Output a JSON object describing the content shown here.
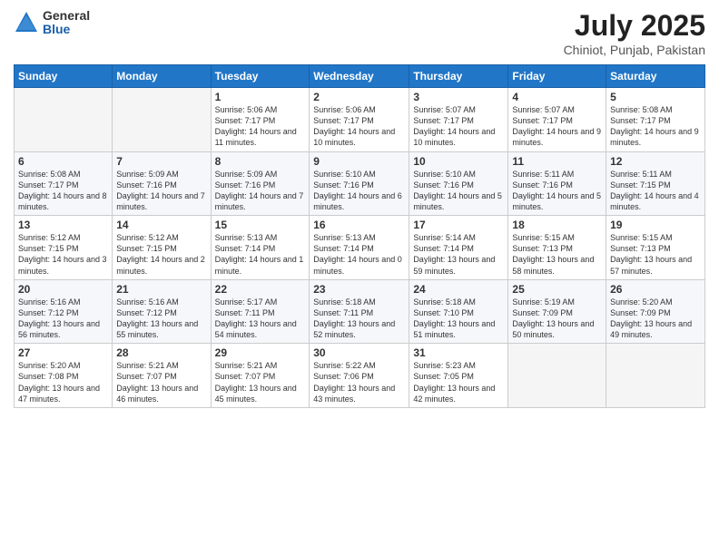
{
  "logo": {
    "general": "General",
    "blue": "Blue"
  },
  "title": "July 2025",
  "subtitle": "Chiniot, Punjab, Pakistan",
  "headers": [
    "Sunday",
    "Monday",
    "Tuesday",
    "Wednesday",
    "Thursday",
    "Friday",
    "Saturday"
  ],
  "weeks": [
    [
      {
        "day": "",
        "info": ""
      },
      {
        "day": "",
        "info": ""
      },
      {
        "day": "1",
        "info": "Sunrise: 5:06 AM\nSunset: 7:17 PM\nDaylight: 14 hours and 11 minutes."
      },
      {
        "day": "2",
        "info": "Sunrise: 5:06 AM\nSunset: 7:17 PM\nDaylight: 14 hours and 10 minutes."
      },
      {
        "day": "3",
        "info": "Sunrise: 5:07 AM\nSunset: 7:17 PM\nDaylight: 14 hours and 10 minutes."
      },
      {
        "day": "4",
        "info": "Sunrise: 5:07 AM\nSunset: 7:17 PM\nDaylight: 14 hours and 9 minutes."
      },
      {
        "day": "5",
        "info": "Sunrise: 5:08 AM\nSunset: 7:17 PM\nDaylight: 14 hours and 9 minutes."
      }
    ],
    [
      {
        "day": "6",
        "info": "Sunrise: 5:08 AM\nSunset: 7:17 PM\nDaylight: 14 hours and 8 minutes."
      },
      {
        "day": "7",
        "info": "Sunrise: 5:09 AM\nSunset: 7:16 PM\nDaylight: 14 hours and 7 minutes."
      },
      {
        "day": "8",
        "info": "Sunrise: 5:09 AM\nSunset: 7:16 PM\nDaylight: 14 hours and 7 minutes."
      },
      {
        "day": "9",
        "info": "Sunrise: 5:10 AM\nSunset: 7:16 PM\nDaylight: 14 hours and 6 minutes."
      },
      {
        "day": "10",
        "info": "Sunrise: 5:10 AM\nSunset: 7:16 PM\nDaylight: 14 hours and 5 minutes."
      },
      {
        "day": "11",
        "info": "Sunrise: 5:11 AM\nSunset: 7:16 PM\nDaylight: 14 hours and 5 minutes."
      },
      {
        "day": "12",
        "info": "Sunrise: 5:11 AM\nSunset: 7:15 PM\nDaylight: 14 hours and 4 minutes."
      }
    ],
    [
      {
        "day": "13",
        "info": "Sunrise: 5:12 AM\nSunset: 7:15 PM\nDaylight: 14 hours and 3 minutes."
      },
      {
        "day": "14",
        "info": "Sunrise: 5:12 AM\nSunset: 7:15 PM\nDaylight: 14 hours and 2 minutes."
      },
      {
        "day": "15",
        "info": "Sunrise: 5:13 AM\nSunset: 7:14 PM\nDaylight: 14 hours and 1 minute."
      },
      {
        "day": "16",
        "info": "Sunrise: 5:13 AM\nSunset: 7:14 PM\nDaylight: 14 hours and 0 minutes."
      },
      {
        "day": "17",
        "info": "Sunrise: 5:14 AM\nSunset: 7:14 PM\nDaylight: 13 hours and 59 minutes."
      },
      {
        "day": "18",
        "info": "Sunrise: 5:15 AM\nSunset: 7:13 PM\nDaylight: 13 hours and 58 minutes."
      },
      {
        "day": "19",
        "info": "Sunrise: 5:15 AM\nSunset: 7:13 PM\nDaylight: 13 hours and 57 minutes."
      }
    ],
    [
      {
        "day": "20",
        "info": "Sunrise: 5:16 AM\nSunset: 7:12 PM\nDaylight: 13 hours and 56 minutes."
      },
      {
        "day": "21",
        "info": "Sunrise: 5:16 AM\nSunset: 7:12 PM\nDaylight: 13 hours and 55 minutes."
      },
      {
        "day": "22",
        "info": "Sunrise: 5:17 AM\nSunset: 7:11 PM\nDaylight: 13 hours and 54 minutes."
      },
      {
        "day": "23",
        "info": "Sunrise: 5:18 AM\nSunset: 7:11 PM\nDaylight: 13 hours and 52 minutes."
      },
      {
        "day": "24",
        "info": "Sunrise: 5:18 AM\nSunset: 7:10 PM\nDaylight: 13 hours and 51 minutes."
      },
      {
        "day": "25",
        "info": "Sunrise: 5:19 AM\nSunset: 7:09 PM\nDaylight: 13 hours and 50 minutes."
      },
      {
        "day": "26",
        "info": "Sunrise: 5:20 AM\nSunset: 7:09 PM\nDaylight: 13 hours and 49 minutes."
      }
    ],
    [
      {
        "day": "27",
        "info": "Sunrise: 5:20 AM\nSunset: 7:08 PM\nDaylight: 13 hours and 47 minutes."
      },
      {
        "day": "28",
        "info": "Sunrise: 5:21 AM\nSunset: 7:07 PM\nDaylight: 13 hours and 46 minutes."
      },
      {
        "day": "29",
        "info": "Sunrise: 5:21 AM\nSunset: 7:07 PM\nDaylight: 13 hours and 45 minutes."
      },
      {
        "day": "30",
        "info": "Sunrise: 5:22 AM\nSunset: 7:06 PM\nDaylight: 13 hours and 43 minutes."
      },
      {
        "day": "31",
        "info": "Sunrise: 5:23 AM\nSunset: 7:05 PM\nDaylight: 13 hours and 42 minutes."
      },
      {
        "day": "",
        "info": ""
      },
      {
        "day": "",
        "info": ""
      }
    ]
  ]
}
